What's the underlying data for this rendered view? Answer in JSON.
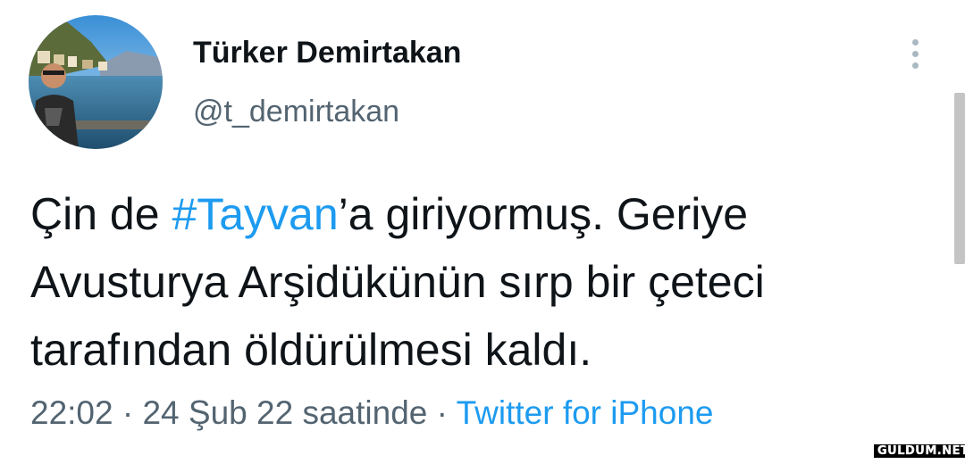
{
  "user": {
    "display_name": "Türker Demirtakan",
    "handle": "@t_demirtakan",
    "avatar_icon": "profile-photo"
  },
  "menu": {
    "icon": "more-vertical-icon"
  },
  "tweet": {
    "line1_prefix": "Çin de ",
    "hashtag": "#Tayvan",
    "line1_suffix": "’a giriyormuş. Geriye",
    "line2": "Avusturya Arşidükünün sırp bir çeteci",
    "line3": "tarafından öldürülmesi kaldı."
  },
  "meta": {
    "time": "22:02",
    "sep1": " · ",
    "date": "24 Şub 22 saatinde",
    "sep2": " · ",
    "source": "Twitter for iPhone"
  },
  "watermark": "GULDUM.NET",
  "colors": {
    "link": "#1d9bf0",
    "secondary": "#536471",
    "text": "#0f1419"
  }
}
